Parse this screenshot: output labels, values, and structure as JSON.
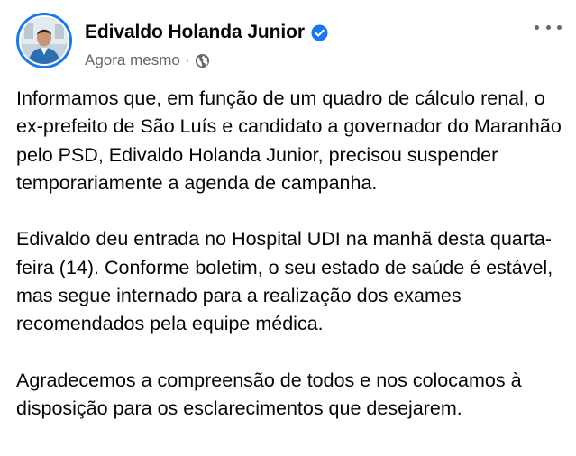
{
  "post": {
    "author": {
      "name": "Edivaldo Holanda Junior",
      "avatar_icon": "profile-photo",
      "verified_icon": "verified-badge-icon",
      "verified_color": "#1877f2"
    },
    "meta": {
      "timestamp": "Agora mesmo",
      "separator": "·",
      "audience_icon": "globe-icon"
    },
    "more_icon": "more-options-icon",
    "paragraphs": [
      "Informamos que, em função de um quadro de cálculo renal, o ex-prefeito de São Luís e candidato a governador do Maranhão pelo PSD, Edivaldo Holanda Junior, precisou suspender temporariamente a agenda de campanha.",
      "Edivaldo deu entrada no Hospital UDI na manhã desta quarta-feira (14). Conforme boletim, o seu estado de saúde é estável, mas segue internado para a realização dos exames recomendados pela equipe médica.",
      "Agradecemos a compreensão de todos e nos colocamos à disposição para os esclarecimentos que desejarem."
    ],
    "colors": {
      "text": "#050505",
      "secondary_text": "#65676b",
      "accent": "#1877f2"
    }
  }
}
